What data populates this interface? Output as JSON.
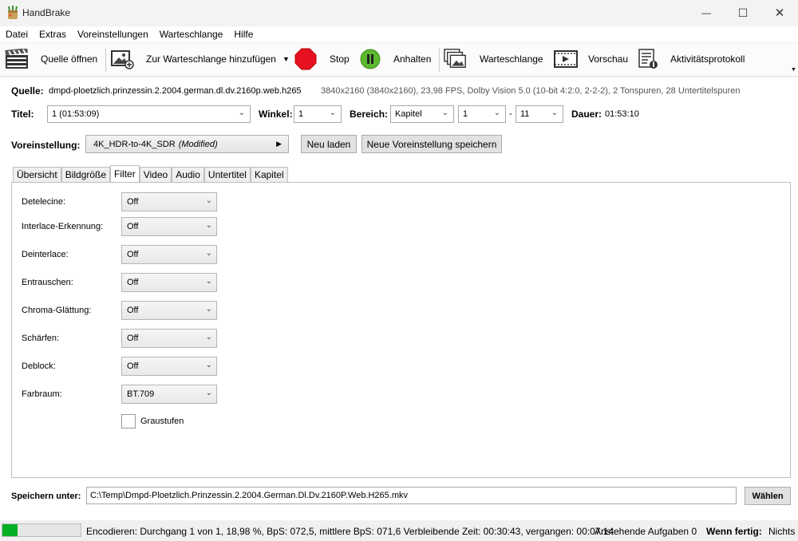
{
  "window": {
    "title": "HandBrake",
    "minimize": "—",
    "maximize": "☐",
    "close": "✕"
  },
  "menu": [
    "Datei",
    "Extras",
    "Voreinstellungen",
    "Warteschlange",
    "Hilfe"
  ],
  "toolbar": {
    "open_source": "Quelle öffnen",
    "add_queue": "Zur Warteschlange hinzufügen",
    "stop": "Stop",
    "pause": "Anhalten",
    "queue": "Warteschlange",
    "preview": "Vorschau",
    "activity_log": "Aktivitätsprotokoll"
  },
  "source": {
    "label": "Quelle:",
    "name": "dmpd-ploetzlich.prinzessin.2.2004.german.dl.dv.2160p.web.h265",
    "info": "3840x2160 (3840x2160), 23,98 FPS, Dolby Vision 5.0 (10-bit 4:2:0, 2-2-2), 2 Tonspuren, 28 Untertitelspuren"
  },
  "title_row": {
    "title_label": "Titel:",
    "title_value": "1 (01:53:09)",
    "angle_label": "Winkel:",
    "angle_value": "1",
    "range_label": "Bereich:",
    "range_type": "Kapitel",
    "range_start": "1",
    "range_dash": "-",
    "range_end": "11",
    "duration_label": "Dauer:",
    "duration_value": "01:53:10"
  },
  "preset": {
    "label": "Voreinstellung:",
    "name": "4K_HDR-to-4K_SDR",
    "modified": "(Modified)",
    "reload": "Neu laden",
    "save_new": "Neue Voreinstellung speichern"
  },
  "tabs": [
    "Übersicht",
    "Bildgröße",
    "Filter",
    "Video",
    "Audio",
    "Untertitel",
    "Kapitel"
  ],
  "active_tab": "Filter",
  "filters": [
    {
      "label": "Detelecine:",
      "value": "Off"
    },
    {
      "label": "Interlace-Erkennung:",
      "value": "Off"
    },
    {
      "label": "Deinterlace:",
      "value": "Off"
    },
    {
      "label": "Entrauschen:",
      "value": "Off"
    },
    {
      "label": "Chroma-Glättung:",
      "value": "Off"
    },
    {
      "label": "Schärfen:",
      "value": "Off"
    },
    {
      "label": "Deblock:",
      "value": "Off"
    },
    {
      "label": "Farbraum:",
      "value": "BT.709"
    }
  ],
  "grayscale": {
    "label": "Graustufen",
    "checked": false
  },
  "save": {
    "label": "Speichern unter:",
    "path": "C:\\Temp\\Dmpd-Ploetzlich.Prinzessin.2.2004.German.Dl.Dv.2160P.Web.H265.mkv",
    "browse": "Wählen"
  },
  "status": {
    "progress_percent": 18.98,
    "encoding": "Encodieren: Durchgang 1 von 1, 18,98 %, BpS: 072,5, mittlere BpS: 071,6 Verbleibende Zeit: 00:30:43, vergangen: 00:07:14",
    "pending": "Anstehende Aufgaben 0",
    "when_done_label": "Wenn fertig:",
    "when_done_value": "Nichts"
  },
  "colors": {
    "stop": "#e81123",
    "pause": "#5cb82e",
    "progress": "#06b025"
  }
}
